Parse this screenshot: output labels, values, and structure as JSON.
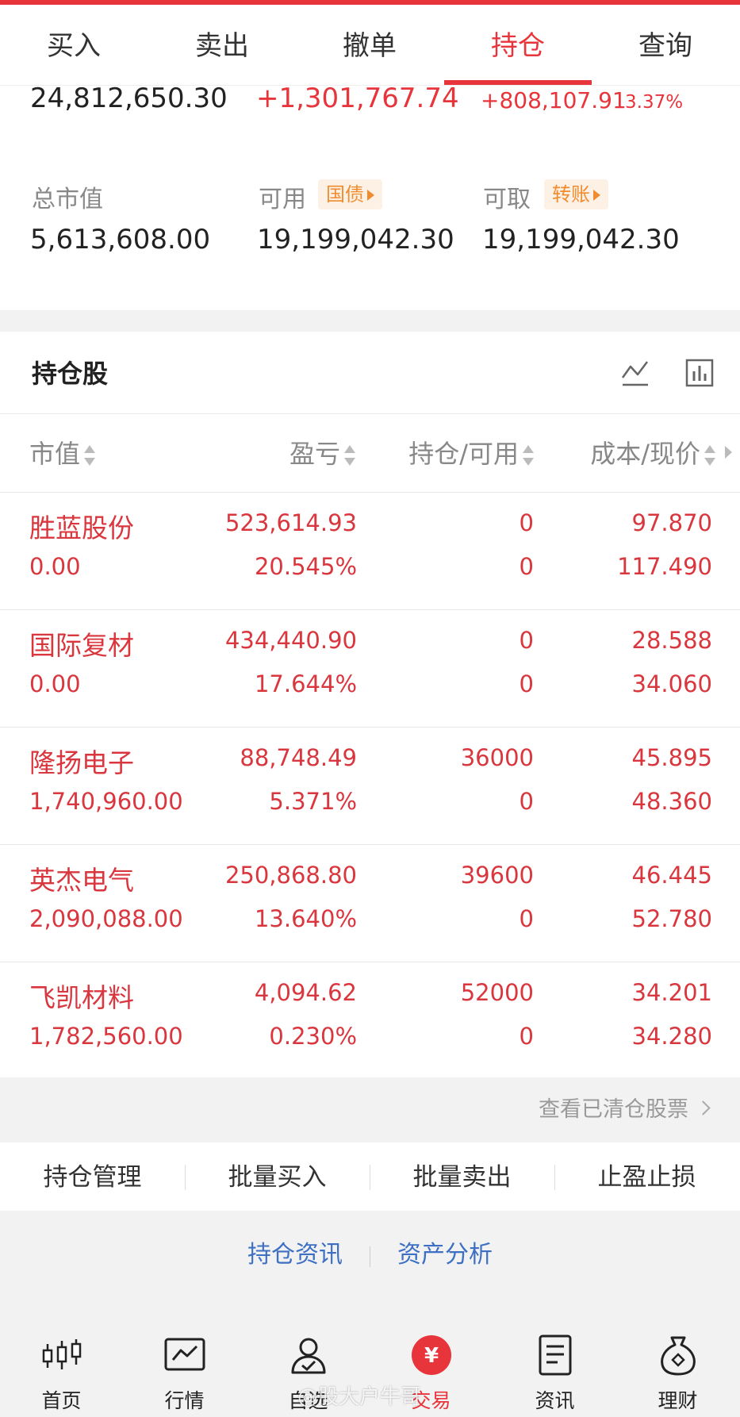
{
  "tabs": [
    {
      "label": "买入",
      "active": false
    },
    {
      "label": "卖出",
      "active": false
    },
    {
      "label": "撤单",
      "active": false
    },
    {
      "label": "持仓",
      "active": true
    },
    {
      "label": "查询",
      "active": false
    }
  ],
  "summary": {
    "total_assets": "24,812,650.30",
    "float_pnl": "+1,301,767.74",
    "today_pnl": "+808,107.91",
    "today_pnl_pct": "3.37%",
    "market_value_label": "总市值",
    "market_value": "5,613,608.00",
    "available_label": "可用",
    "available_chip": "国债",
    "available": "19,199,042.30",
    "withdrawable_label": "可取",
    "withdrawable_chip": "转账",
    "withdrawable": "19,199,042.30"
  },
  "holdings": {
    "title": "持仓股",
    "columns": [
      "市值",
      "盈亏",
      "持仓/可用",
      "成本/现价"
    ],
    "rows": [
      {
        "name": "胜蓝股份",
        "market_value": "0.00",
        "pnl": "523,614.93",
        "pnl_pct": "20.545%",
        "position": "0",
        "available": "0",
        "cost": "97.870",
        "price": "117.490"
      },
      {
        "name": "国际复材",
        "market_value": "0.00",
        "pnl": "434,440.90",
        "pnl_pct": "17.644%",
        "position": "0",
        "available": "0",
        "cost": "28.588",
        "price": "34.060"
      },
      {
        "name": "隆扬电子",
        "market_value": "1,740,960.00",
        "pnl": "88,748.49",
        "pnl_pct": "5.371%",
        "position": "36000",
        "available": "0",
        "cost": "45.895",
        "price": "48.360"
      },
      {
        "name": "英杰电气",
        "market_value": "2,090,088.00",
        "pnl": "250,868.80",
        "pnl_pct": "13.640%",
        "position": "39600",
        "available": "0",
        "cost": "46.445",
        "price": "52.780"
      },
      {
        "name": "飞凯材料",
        "market_value": "1,782,560.00",
        "pnl": "4,094.62",
        "pnl_pct": "0.230%",
        "position": "52000",
        "available": "0",
        "cost": "34.201",
        "price": "34.280"
      }
    ],
    "cleared_link": "查看已清仓股票"
  },
  "actions": [
    "持仓管理",
    "批量买入",
    "批量卖出",
    "止盈止损"
  ],
  "links": {
    "position_news": "持仓资讯",
    "asset_analysis": "资产分析"
  },
  "bottom_nav": [
    {
      "label": "首页",
      "icon": "candlestick-icon"
    },
    {
      "label": "行情",
      "icon": "market-chart-icon"
    },
    {
      "label": "自选",
      "icon": "user-check-icon"
    },
    {
      "label": "交易",
      "icon": "yuan-icon",
      "active": true
    },
    {
      "label": "资讯",
      "icon": "document-icon"
    },
    {
      "label": "理财",
      "icon": "money-bag-icon"
    }
  ],
  "watermark": "@股大户牛哥",
  "colors": {
    "accent": "#e8343b",
    "gain": "#d9363e",
    "link": "#3d6fc3",
    "chip": "#f08c2d"
  }
}
